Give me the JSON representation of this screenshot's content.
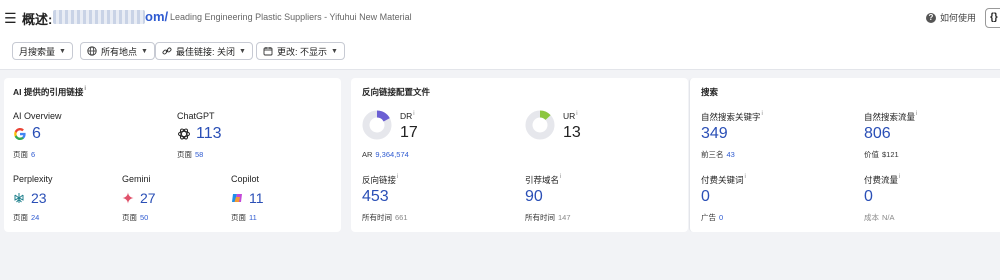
{
  "header": {
    "title_prefix": "概述:",
    "domain_suffix": "om/",
    "subtitle": "Leading Engineering Plastic Suppliers - Yifuhui New Material",
    "help_label": "如何使用",
    "code_button": "{}"
  },
  "filters": [
    {
      "label": "月搜索量"
    },
    {
      "label": "所有地点"
    },
    {
      "label": "最佳链接: 关闭"
    },
    {
      "label": "更改: 不显示"
    }
  ],
  "ai_card": {
    "title": "AI 提供的引用链接",
    "info": "i",
    "items": [
      {
        "name": "AI Overview",
        "value": "6",
        "pages_label": "页面",
        "pages": "6"
      },
      {
        "name": "ChatGPT",
        "value": "113",
        "pages_label": "页面",
        "pages": "58"
      },
      {
        "name": "Perplexity",
        "value": "23",
        "pages_label": "页面",
        "pages": "24"
      },
      {
        "name": "Gemini",
        "value": "27",
        "pages_label": "页面",
        "pages": "50"
      },
      {
        "name": "Copilot",
        "value": "11",
        "pages_label": "页面",
        "pages": "11"
      }
    ]
  },
  "backlink_card": {
    "title": "反向链接配置文件",
    "dr": {
      "label": "DR",
      "value": "17",
      "gauge": 0.17
    },
    "ur": {
      "label": "UR",
      "value": "13",
      "gauge": 0.13
    },
    "ar_label": "AR",
    "ar_value": "9,364,574",
    "backlinks": {
      "label": "反向链接",
      "value": "453",
      "sub_label": "所有时间",
      "sub_value": "661"
    },
    "ref_domains": {
      "label": "引荐域名",
      "value": "90",
      "sub_label": "所有时间",
      "sub_value": "147"
    }
  },
  "search_card": {
    "title": "搜索",
    "organic_keywords": {
      "label": "自然搜索关键字",
      "value": "349",
      "sub_label": "前三名",
      "sub_value": "43"
    },
    "organic_traffic": {
      "label": "自然搜索流量",
      "value": "806",
      "sub_label": "价值",
      "sub_value": "$121"
    },
    "paid_keywords": {
      "label": "付费关键词",
      "value": "0",
      "sub_label": "广告",
      "sub_value": "0"
    },
    "paid_traffic": {
      "label": "付费流量",
      "value": "0",
      "sub_label": "成本",
      "sub_value": "N/A"
    }
  },
  "colors": {
    "accent": "#2a4fb6",
    "dr_gauge": "#6b5fd3",
    "ur_gauge": "#8cc63f",
    "gauge_track": "#e6e7ec"
  }
}
